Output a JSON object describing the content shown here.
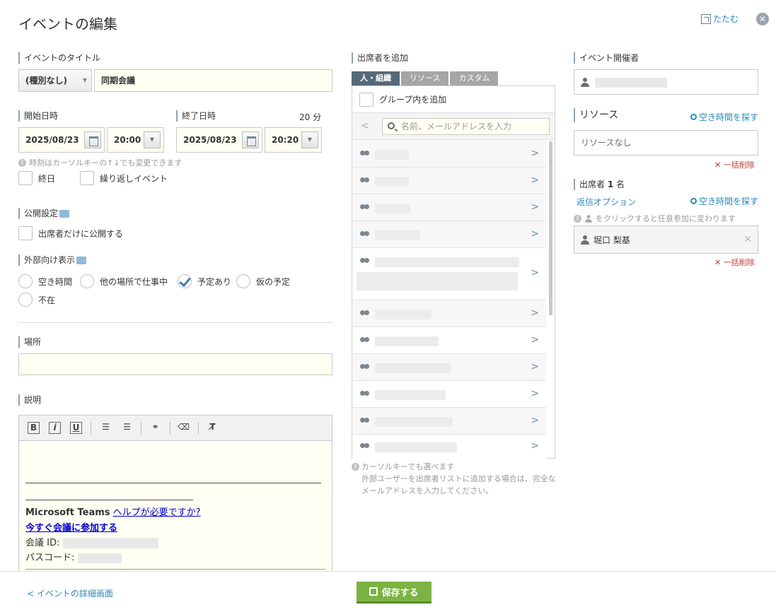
{
  "header": {
    "title": "イベントの編集",
    "collapse_label": "たたむ"
  },
  "event_title": {
    "label": "イベントのタイトル",
    "category": "(種別なし)",
    "value": "同期会議"
  },
  "datetime": {
    "start_label": "開始日時",
    "end_label": "終了日時",
    "duration": "20 分",
    "start_date": "2025/08/23",
    "start_time": "20:00",
    "end_date": "2025/08/23",
    "end_time": "20:20",
    "hint": "時刻はカーソルキーの↑↓でも変更できます",
    "all_day": "終日",
    "repeat": "繰り返しイベント"
  },
  "visibility": {
    "label": "公開設定",
    "attendees_only": "出席者だけに公開する"
  },
  "external": {
    "label": "外部向け表示",
    "options": [
      "空き時間",
      "他の場所で仕事中",
      "予定あり",
      "仮の予定",
      "不在"
    ],
    "selected": "予定あり"
  },
  "location": {
    "label": "場所",
    "value": ""
  },
  "description": {
    "label": "説明",
    "toolbar": [
      "B",
      "i",
      "U"
    ],
    "teams_label": "Microsoft Teams",
    "help_link": "ヘルプが必要ですか?",
    "join_link": "今すぐ会議に参加する",
    "meeting_id_label": "会議 ID:",
    "passcode_label": "パスコード:"
  },
  "attendee_picker": {
    "label": "出席者を追加",
    "tabs": [
      "人・組織",
      "リソース",
      "カスタム"
    ],
    "active_tab": "人・組織",
    "group_add": "グループ内を追加",
    "search_placeholder": "名前、メールアドレスを入力",
    "note_line1": "カーソルキーでも選べます",
    "note_line2": "外部ユーザーを出席者リストに追加する場合は、完全なメールアドレスを入力してください。"
  },
  "organizer": {
    "label": "イベント開催者"
  },
  "resources": {
    "label": "リソース",
    "find_time": "空き時間を探す",
    "value": "リソースなし",
    "clear_all": "一括削除"
  },
  "attendees": {
    "label_prefix": "出席者",
    "count": "1",
    "label_suffix": "名",
    "reply_options": "返信オプション",
    "find_time": "空き時間を探す",
    "hint": "をクリックすると任意参加に変わります",
    "name": "堀口 梨基",
    "clear_all": "一括削除"
  },
  "footer": {
    "back_link": "< イベントの詳細画面",
    "save": "保存する"
  }
}
